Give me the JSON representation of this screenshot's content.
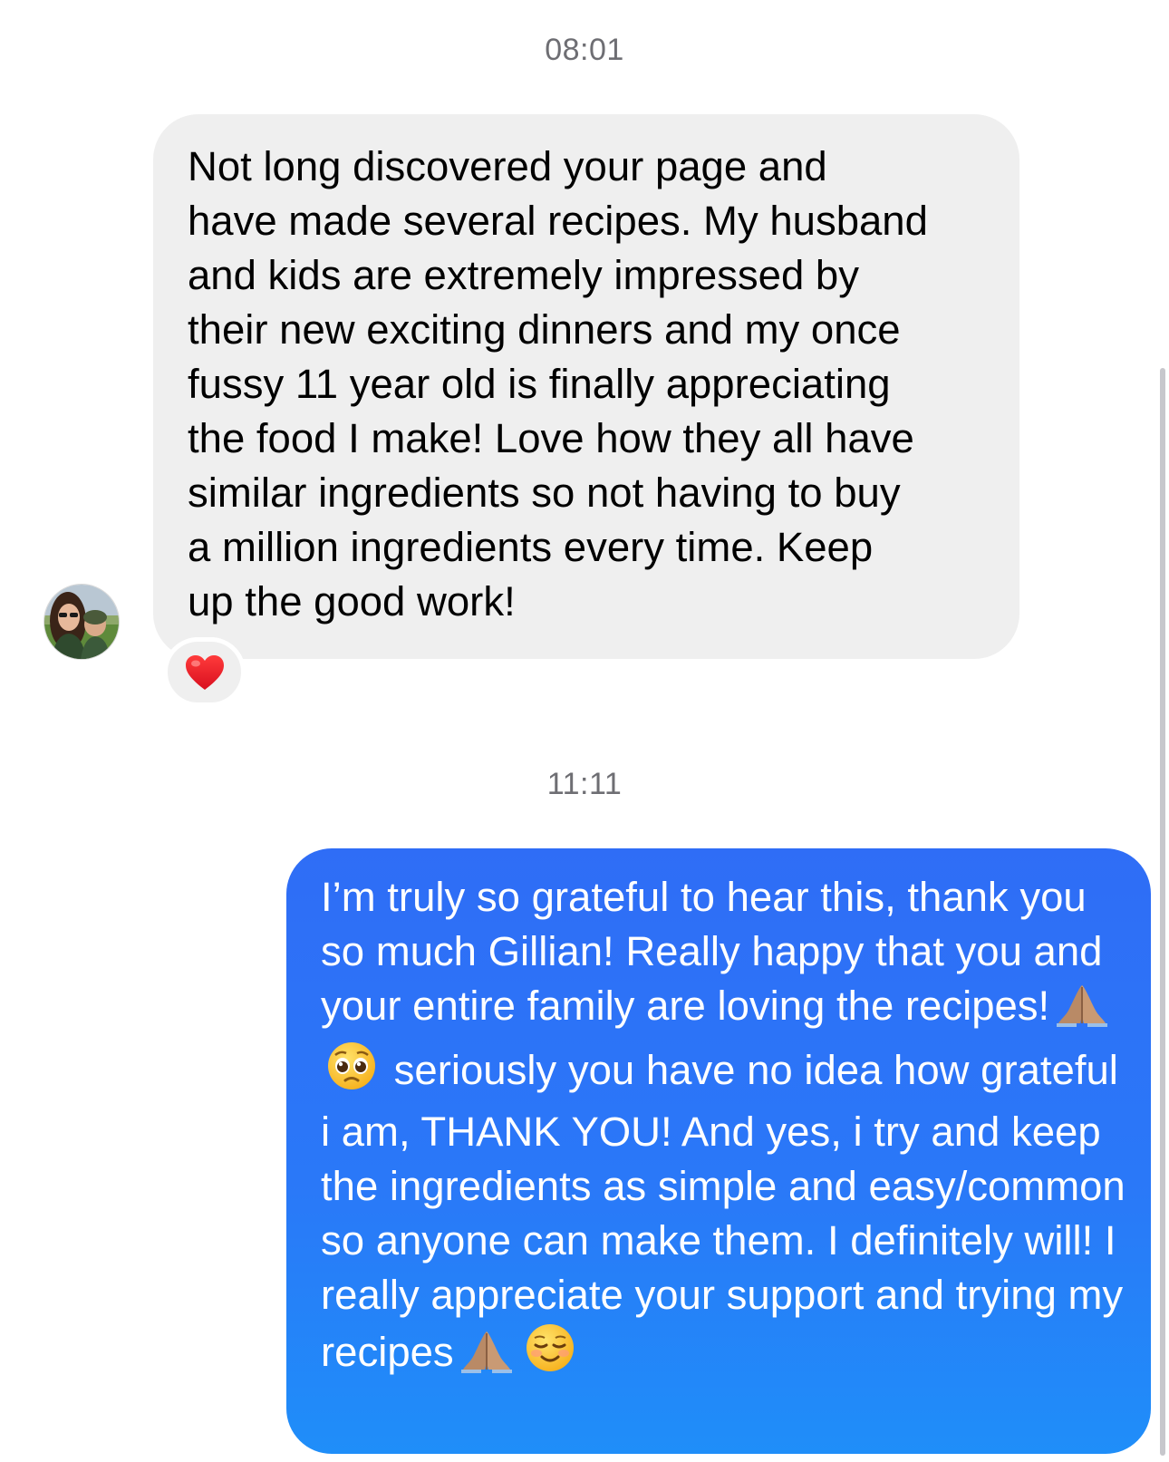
{
  "conversation": {
    "timestamp_1": "08:01",
    "timestamp_2": "11:11",
    "incoming": {
      "text": "Not long discovered your page and\nhave made several recipes. My husband\nand kids are extremely impressed by\ntheir new exciting dinners and my once\nfussy 11 year old is finally appreciating\nthe food I make! Love how they all have\nsimilar ingredients so not having to buy\na million ingredients every time. Keep\nup the good work!",
      "reaction": "heart-emoji",
      "bubble_color": "#efefef"
    },
    "outgoing": {
      "part1": "I’m truly so grateful to hear this, thank you so much Gillian! Really happy that you and your entire family are loving the recipes!",
      "emoji_1": "folded-hands-emoji",
      "emoji_2": "pleading-face-emoji",
      "part2": " seriously you have no idea how grateful i am, THANK YOU! And yes, i try and keep the ingredients as simple and easy/common so anyone can make them. I definitely will! I really appreciate your support and trying my recipes",
      "emoji_3": "folded-hands-emoji",
      "emoji_4": "smiling-face-emoji",
      "bubble_color": "#2a78f8"
    }
  }
}
